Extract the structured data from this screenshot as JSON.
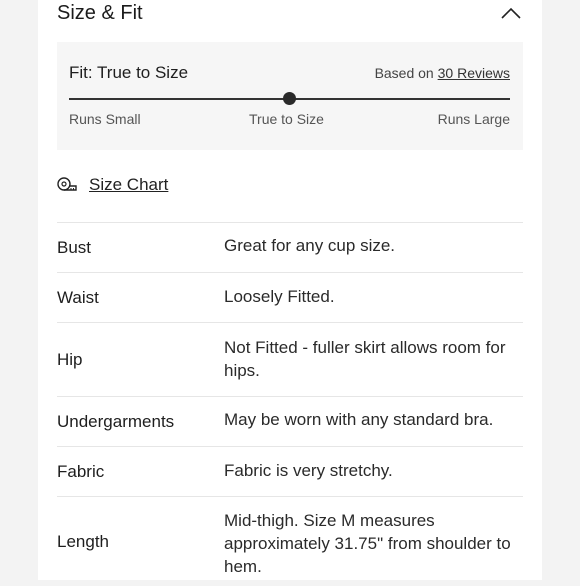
{
  "section": {
    "title": "Size & Fit",
    "toggle_icon": "chevron-up-icon"
  },
  "fit": {
    "title": "Fit: True to Size",
    "based_on_prefix": "Based on ",
    "reviews_link": "30 Reviews",
    "scale_labels": [
      "Runs Small",
      "True to Size",
      "Runs Large"
    ],
    "position": 0.5
  },
  "size_chart": {
    "label": "Size Chart",
    "icon": "measuring-tape-icon"
  },
  "details": [
    {
      "label": "Bust",
      "value": "Great for any cup size."
    },
    {
      "label": "Waist",
      "value": "Loosely Fitted."
    },
    {
      "label": "Hip",
      "value": "Not Fitted - fuller skirt allows room for hips."
    },
    {
      "label": "Undergarments",
      "value": "May be worn with any standard bra."
    },
    {
      "label": "Fabric",
      "value": "Fabric is very stretchy."
    },
    {
      "label": "Length",
      "value": "Mid-thigh. Size M measures approximately 31.75\" from shoulder to hem."
    }
  ]
}
